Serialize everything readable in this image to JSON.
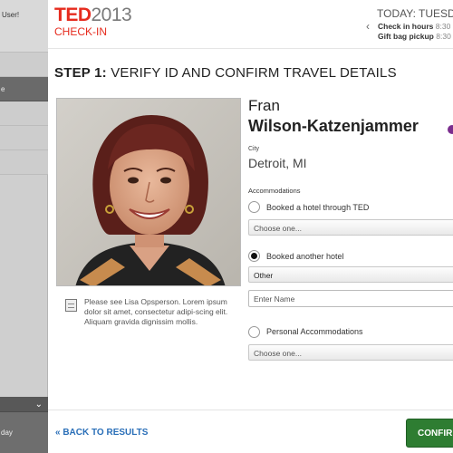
{
  "sidebar": {
    "greeting": "User!",
    "items": [
      {
        "label": ""
      },
      {
        "label": "e"
      },
      {
        "label": ""
      },
      {
        "label": ""
      },
      {
        "label": ""
      }
    ],
    "bottom_label": "day"
  },
  "header": {
    "logo_ted": "TED",
    "logo_year": "2013",
    "checkin": "CHECK-IN",
    "today": "TODAY: TUESDAY",
    "schedule": [
      {
        "label": "Check in hours",
        "time": "8:30"
      },
      {
        "label": "Gift bag pickup",
        "time": "8:30"
      }
    ]
  },
  "step": {
    "prefix": "STEP 1:",
    "title": "VERIFY ID AND CONFIRM TRAVEL DETAILS"
  },
  "attendee": {
    "first_name": "Fran",
    "last_name": "Wilson-Katzenjammer",
    "city_label": "City",
    "city": "Detroit, MI"
  },
  "note": "Please see Lisa Opsperson. Lorem ipsum dolor sit amet, consectetur adipi-scing elit. Aliquam gravida dignissim mollis.",
  "accommodations": {
    "label": "Accommodations",
    "options": [
      {
        "label": "Booked a hotel through TED",
        "selected": false,
        "select_value": "Choose one..."
      },
      {
        "label": "Booked another hotel",
        "selected": true,
        "select_value": "Other",
        "input_placeholder": "Enter Name"
      },
      {
        "label": "Personal Accommodations",
        "selected": false,
        "select_value": "Choose one..."
      }
    ]
  },
  "footer": {
    "back": "« BACK TO RESULTS",
    "confirm": "CONFIRM"
  },
  "colors": {
    "ted_red": "#e62b1e",
    "confirm_green": "#2e7d32",
    "link_blue": "#2a6fb8",
    "status_purple": "#7b2d8e"
  }
}
